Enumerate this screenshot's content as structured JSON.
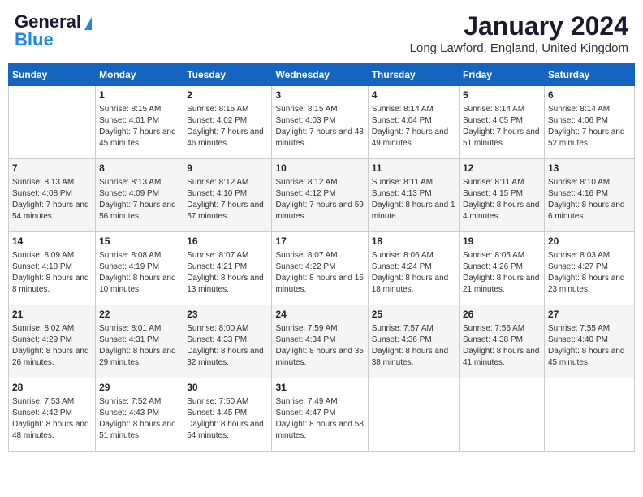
{
  "header": {
    "logo_line1": "General",
    "logo_line2": "Blue",
    "month_title": "January 2024",
    "location": "Long Lawford, England, United Kingdom"
  },
  "days_of_week": [
    "Sunday",
    "Monday",
    "Tuesday",
    "Wednesday",
    "Thursday",
    "Friday",
    "Saturday"
  ],
  "weeks": [
    [
      {
        "day": "",
        "sunrise": "",
        "sunset": "",
        "daylight": ""
      },
      {
        "day": "1",
        "sunrise": "Sunrise: 8:15 AM",
        "sunset": "Sunset: 4:01 PM",
        "daylight": "Daylight: 7 hours and 45 minutes."
      },
      {
        "day": "2",
        "sunrise": "Sunrise: 8:15 AM",
        "sunset": "Sunset: 4:02 PM",
        "daylight": "Daylight: 7 hours and 46 minutes."
      },
      {
        "day": "3",
        "sunrise": "Sunrise: 8:15 AM",
        "sunset": "Sunset: 4:03 PM",
        "daylight": "Daylight: 7 hours and 48 minutes."
      },
      {
        "day": "4",
        "sunrise": "Sunrise: 8:14 AM",
        "sunset": "Sunset: 4:04 PM",
        "daylight": "Daylight: 7 hours and 49 minutes."
      },
      {
        "day": "5",
        "sunrise": "Sunrise: 8:14 AM",
        "sunset": "Sunset: 4:05 PM",
        "daylight": "Daylight: 7 hours and 51 minutes."
      },
      {
        "day": "6",
        "sunrise": "Sunrise: 8:14 AM",
        "sunset": "Sunset: 4:06 PM",
        "daylight": "Daylight: 7 hours and 52 minutes."
      }
    ],
    [
      {
        "day": "7",
        "sunrise": "Sunrise: 8:13 AM",
        "sunset": "Sunset: 4:08 PM",
        "daylight": "Daylight: 7 hours and 54 minutes."
      },
      {
        "day": "8",
        "sunrise": "Sunrise: 8:13 AM",
        "sunset": "Sunset: 4:09 PM",
        "daylight": "Daylight: 7 hours and 56 minutes."
      },
      {
        "day": "9",
        "sunrise": "Sunrise: 8:12 AM",
        "sunset": "Sunset: 4:10 PM",
        "daylight": "Daylight: 7 hours and 57 minutes."
      },
      {
        "day": "10",
        "sunrise": "Sunrise: 8:12 AM",
        "sunset": "Sunset: 4:12 PM",
        "daylight": "Daylight: 7 hours and 59 minutes."
      },
      {
        "day": "11",
        "sunrise": "Sunrise: 8:11 AM",
        "sunset": "Sunset: 4:13 PM",
        "daylight": "Daylight: 8 hours and 1 minute."
      },
      {
        "day": "12",
        "sunrise": "Sunrise: 8:11 AM",
        "sunset": "Sunset: 4:15 PM",
        "daylight": "Daylight: 8 hours and 4 minutes."
      },
      {
        "day": "13",
        "sunrise": "Sunrise: 8:10 AM",
        "sunset": "Sunset: 4:16 PM",
        "daylight": "Daylight: 8 hours and 6 minutes."
      }
    ],
    [
      {
        "day": "14",
        "sunrise": "Sunrise: 8:09 AM",
        "sunset": "Sunset: 4:18 PM",
        "daylight": "Daylight: 8 hours and 8 minutes."
      },
      {
        "day": "15",
        "sunrise": "Sunrise: 8:08 AM",
        "sunset": "Sunset: 4:19 PM",
        "daylight": "Daylight: 8 hours and 10 minutes."
      },
      {
        "day": "16",
        "sunrise": "Sunrise: 8:07 AM",
        "sunset": "Sunset: 4:21 PM",
        "daylight": "Daylight: 8 hours and 13 minutes."
      },
      {
        "day": "17",
        "sunrise": "Sunrise: 8:07 AM",
        "sunset": "Sunset: 4:22 PM",
        "daylight": "Daylight: 8 hours and 15 minutes."
      },
      {
        "day": "18",
        "sunrise": "Sunrise: 8:06 AM",
        "sunset": "Sunset: 4:24 PM",
        "daylight": "Daylight: 8 hours and 18 minutes."
      },
      {
        "day": "19",
        "sunrise": "Sunrise: 8:05 AM",
        "sunset": "Sunset: 4:26 PM",
        "daylight": "Daylight: 8 hours and 21 minutes."
      },
      {
        "day": "20",
        "sunrise": "Sunrise: 8:03 AM",
        "sunset": "Sunset: 4:27 PM",
        "daylight": "Daylight: 8 hours and 23 minutes."
      }
    ],
    [
      {
        "day": "21",
        "sunrise": "Sunrise: 8:02 AM",
        "sunset": "Sunset: 4:29 PM",
        "daylight": "Daylight: 8 hours and 26 minutes."
      },
      {
        "day": "22",
        "sunrise": "Sunrise: 8:01 AM",
        "sunset": "Sunset: 4:31 PM",
        "daylight": "Daylight: 8 hours and 29 minutes."
      },
      {
        "day": "23",
        "sunrise": "Sunrise: 8:00 AM",
        "sunset": "Sunset: 4:33 PM",
        "daylight": "Daylight: 8 hours and 32 minutes."
      },
      {
        "day": "24",
        "sunrise": "Sunrise: 7:59 AM",
        "sunset": "Sunset: 4:34 PM",
        "daylight": "Daylight: 8 hours and 35 minutes."
      },
      {
        "day": "25",
        "sunrise": "Sunrise: 7:57 AM",
        "sunset": "Sunset: 4:36 PM",
        "daylight": "Daylight: 8 hours and 38 minutes."
      },
      {
        "day": "26",
        "sunrise": "Sunrise: 7:56 AM",
        "sunset": "Sunset: 4:38 PM",
        "daylight": "Daylight: 8 hours and 41 minutes."
      },
      {
        "day": "27",
        "sunrise": "Sunrise: 7:55 AM",
        "sunset": "Sunset: 4:40 PM",
        "daylight": "Daylight: 8 hours and 45 minutes."
      }
    ],
    [
      {
        "day": "28",
        "sunrise": "Sunrise: 7:53 AM",
        "sunset": "Sunset: 4:42 PM",
        "daylight": "Daylight: 8 hours and 48 minutes."
      },
      {
        "day": "29",
        "sunrise": "Sunrise: 7:52 AM",
        "sunset": "Sunset: 4:43 PM",
        "daylight": "Daylight: 8 hours and 51 minutes."
      },
      {
        "day": "30",
        "sunrise": "Sunrise: 7:50 AM",
        "sunset": "Sunset: 4:45 PM",
        "daylight": "Daylight: 8 hours and 54 minutes."
      },
      {
        "day": "31",
        "sunrise": "Sunrise: 7:49 AM",
        "sunset": "Sunset: 4:47 PM",
        "daylight": "Daylight: 8 hours and 58 minutes."
      },
      {
        "day": "",
        "sunrise": "",
        "sunset": "",
        "daylight": ""
      },
      {
        "day": "",
        "sunrise": "",
        "sunset": "",
        "daylight": ""
      },
      {
        "day": "",
        "sunrise": "",
        "sunset": "",
        "daylight": ""
      }
    ]
  ]
}
